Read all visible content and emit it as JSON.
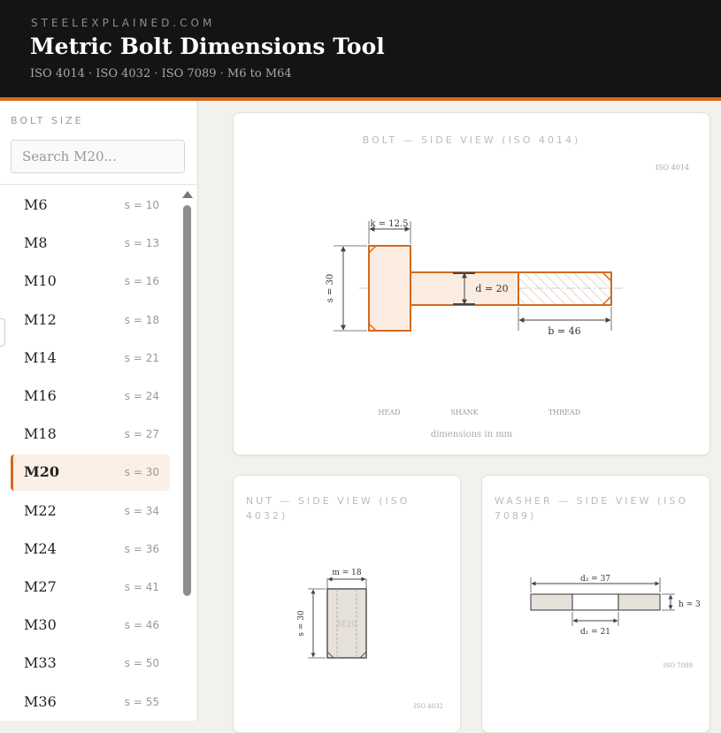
{
  "header": {
    "brand": "STEELEXPLAINED.COM",
    "title": "Metric Bolt Dimensions Tool",
    "subtitle": "ISO 4014 · ISO 4032 · ISO 7089 · M6 to M64"
  },
  "sidebar": {
    "label": "BOLT SIZE",
    "search_placeholder": "Search M20...",
    "selected": "M20",
    "items": [
      {
        "size": "M6",
        "s": "s = 10"
      },
      {
        "size": "M8",
        "s": "s = 13"
      },
      {
        "size": "M10",
        "s": "s = 16"
      },
      {
        "size": "M12",
        "s": "s = 18"
      },
      {
        "size": "M14",
        "s": "s = 21"
      },
      {
        "size": "M16",
        "s": "s = 24"
      },
      {
        "size": "M18",
        "s": "s = 27"
      },
      {
        "size": "M20",
        "s": "s = 30"
      },
      {
        "size": "M22",
        "s": "s = 34"
      },
      {
        "size": "M24",
        "s": "s = 36"
      },
      {
        "size": "M27",
        "s": "s = 41"
      },
      {
        "size": "M30",
        "s": "s = 46"
      },
      {
        "size": "M33",
        "s": "s = 50"
      },
      {
        "size": "M36",
        "s": "s = 55"
      }
    ]
  },
  "bolt": {
    "title": "BOLT — SIDE VIEW (ISO 4014)",
    "std": "ISO 4014",
    "k_label": "k = 12.5",
    "s_label": "s = 30",
    "d_label": "d = 20",
    "b_label": "b = 46",
    "head_label": "HEAD",
    "shank_label": "SHANK",
    "thread_label": "THREAD",
    "units": "dimensions in mm"
  },
  "nut": {
    "title_line1": "NUT — SIDE VIEW (ISO",
    "title_line2": "4032)",
    "m_label": "m = 18",
    "s_label": "s = 30",
    "watermark": "M20",
    "std": "ISO 4032"
  },
  "washer": {
    "title_line1": "WASHER — SIDE VIEW (ISO",
    "title_line2": "7089)",
    "d2_label": "d₂ = 37",
    "d1_label": "d₁ = 21",
    "h_label": "h = 3",
    "std": "ISO 7089"
  },
  "colors": {
    "accent": "#d46a1e",
    "head_fill": "#fbece2",
    "nut_fill": "#e6e1d9"
  }
}
